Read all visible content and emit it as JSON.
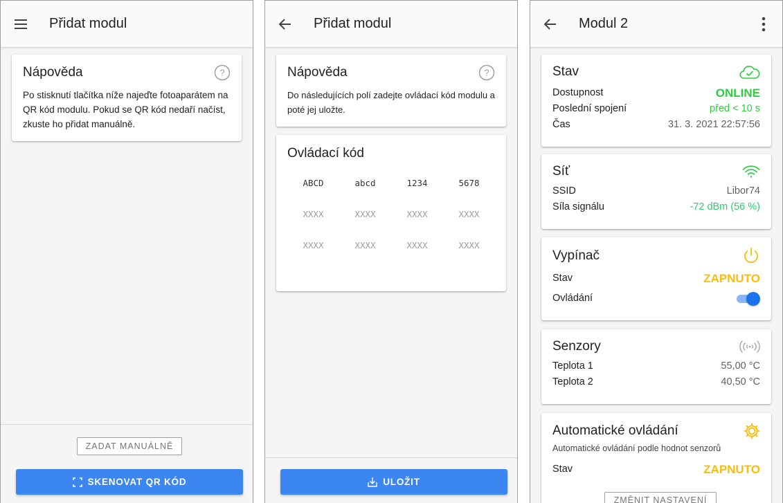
{
  "screen1": {
    "title": "Přidat modul",
    "help": {
      "title": "Nápověda",
      "text": "Po stisknutí tlačítka níže najeďte fotoaparátem na QR kód modulu. Pokud se QR kód nedaří načíst, zkuste ho přidat manuálně."
    },
    "manual_button": "ZADAT MANUÁLNĚ",
    "scan_button": "SKENOVAT QR KÓD"
  },
  "screen2": {
    "title": "Přidat modul",
    "help": {
      "title": "Nápověda",
      "text": "Do následujících polí zadejte ovládací kód modulu a poté jej uložte."
    },
    "code_card": {
      "title": "Ovládací kód",
      "fields": [
        {
          "value": "ABCD",
          "filled": true
        },
        {
          "value": "abcd",
          "filled": true
        },
        {
          "value": "1234",
          "filled": true
        },
        {
          "value": "5678",
          "filled": true
        },
        {
          "value": "XXXX",
          "filled": false
        },
        {
          "value": "XXXX",
          "filled": false
        },
        {
          "value": "XXXX",
          "filled": false
        },
        {
          "value": "XXXX",
          "filled": false
        },
        {
          "value": "XXXX",
          "filled": false
        },
        {
          "value": "XXXX",
          "filled": false
        },
        {
          "value": "XXXX",
          "filled": false
        },
        {
          "value": "XXXX",
          "filled": false
        }
      ]
    },
    "save_button": "ULOŽIT"
  },
  "screen3": {
    "title": "Modul 2",
    "status": {
      "title": "Stav",
      "availability_label": "Dostupnost",
      "availability_value": "ONLINE",
      "last_conn_label": "Poslední spojení",
      "last_conn_value": "před < 10 s",
      "time_label": "Čas",
      "time_value": "31. 3. 2021 22:57:56"
    },
    "network": {
      "title": "Síť",
      "ssid_label": "SSID",
      "ssid_value": "Libor74",
      "signal_label": "Síla signálu",
      "signal_value": "-72 dBm (56 %)"
    },
    "switch": {
      "title": "Vypínač",
      "state_label": "Stav",
      "state_value": "ZAPNUTO",
      "control_label": "Ovládání",
      "toggle_on": true
    },
    "sensors": {
      "title": "Senzory",
      "t1_label": "Teplota 1",
      "t1_value": "55,00 °C",
      "t2_label": "Teplota 2",
      "t2_value": "40,50 °C"
    },
    "auto": {
      "title": "Automatické ovládání",
      "subtitle": "Automatické ovládání podle hodnot senzorů",
      "state_label": "Stav",
      "state_value": "ZAPNUTO",
      "change_button": "ZMĚNIT NASTAVENÍ"
    }
  },
  "colors": {
    "primary": "#3b86f0",
    "online_green": "#2ecc40",
    "amber": "#fbbd08",
    "toggle_blue": "#1a73e8"
  },
  "icons": [
    "menu-icon",
    "back-arrow-icon",
    "help-circle-icon",
    "qr-scan-icon",
    "save-download-icon",
    "more-vert-icon",
    "cloud-check-icon",
    "wifi-icon",
    "power-icon",
    "sensor-wave-icon",
    "gear-icon"
  ]
}
